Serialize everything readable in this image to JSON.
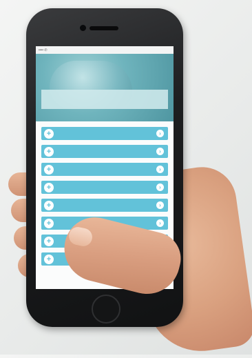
{
  "app": {
    "status_bar": {
      "carrier": "•••• ✆",
      "time": "",
      "battery": ""
    },
    "hero": {
      "title_line_1": "",
      "title_line_2": ""
    },
    "menu": {
      "items": [
        {
          "label": ""
        },
        {
          "label": ""
        },
        {
          "label": ""
        },
        {
          "label": ""
        },
        {
          "label": ""
        },
        {
          "label": ""
        },
        {
          "label": ""
        },
        {
          "label": ""
        }
      ]
    }
  },
  "colors": {
    "menu_button": "#62c2d9",
    "hero_teal": "#6fb4bd",
    "phone_body": "#1d1e20"
  },
  "icons": {
    "expand": "plus-icon",
    "navigate": "chevron-right-icon"
  }
}
